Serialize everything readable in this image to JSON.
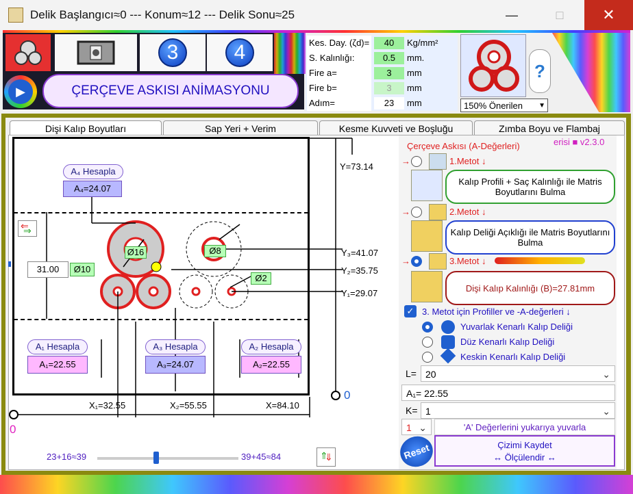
{
  "window": {
    "title": "Delik Başlangıcı≈0 --- Konum≈12 --- Delik Sonu≈25",
    "close_glyph": "✕",
    "maximize_glyph": "□",
    "minimize_glyph": "—"
  },
  "toolbar": {
    "tile3": "3",
    "tile4": "4",
    "animation_label": "ÇERÇEVE ASKISI ANİMASYONU",
    "help_glyph": "?",
    "zoom_select": "150% Önerilen"
  },
  "params": [
    {
      "label": "Kes. Day. (ζd)=",
      "value": "40",
      "unit": "Kg/mm²"
    },
    {
      "label": "S. Kalınlığı: (T)=",
      "value": "0.5",
      "unit": "mm."
    },
    {
      "label": "Fire a=",
      "value": "3",
      "unit": "mm"
    },
    {
      "label": "Fire b=",
      "value": "3",
      "unit": "mm"
    },
    {
      "label": "Adım=",
      "value": "23",
      "unit": "mm"
    }
  ],
  "tabs": [
    "Dişi Kalıp Boyutları",
    "Sap Yeri + Verim",
    "Kesme Kuvveti ve Boşluğu",
    "Zımba Boyu ve Flambaj"
  ],
  "drawing": {
    "a4_button": "A₄ Hesapla",
    "a4_value": "A₄=24.07",
    "a1_button": "A₁ Hesapla",
    "a1_value": "A₁=22.55",
    "a3_button": "A₃ Hesapla",
    "a3_value": "A₃=24.07",
    "a2_button": "A₂ Hesapla",
    "a2_value": "A₂=22.55",
    "height_value": "31.00",
    "d16": "Ø16",
    "d10": "Ø10",
    "d8": "Ø8",
    "d2": "Ø2",
    "y": "Y=73.14",
    "y3": "Y₃=41.07",
    "y2": "Y₂=35.75",
    "y1": "Y₁=29.07",
    "x1": "X₁=32.55",
    "x2": "X₂=55.55",
    "x": "X=84.10",
    "origin_right": "0",
    "origin_left": "0",
    "slider_left": "23+16≈39",
    "slider_right": "39+45≈84"
  },
  "right_panel": {
    "header": "Çerçeve Askısı (A-Değerleri)",
    "version": "erisi ■ v2.3.0",
    "m1_label": "1.Metot ↓",
    "m1_button": "Kalıp Profili + Saç Kalınlığı ile Matris Boyutlarını Bulma",
    "m2_label": "2.Metot ↓",
    "m2_button": "Kalıp Deliği Açıklığı ile Matris Boyutlarını Bulma",
    "m3_label": "3.Metot ↓",
    "m3_button": "Dişi Kalıp Kalınlığı (B)=27.81mm",
    "checkbox_label": "3. Metot için Profiller ve -A-değerleri ↓",
    "options": [
      "Yuvarlak Kenarlı Kalıp Deliği",
      "Düz Kenarlı Kalıp Deliği",
      "Keskin Kenarlı Kalıp Deliği"
    ],
    "l_label": "L=",
    "l_value": "20",
    "a1_text": "A₁= 22.55",
    "k_label": "K=",
    "k_value": "1",
    "round_select": "1",
    "round_text": "'A' Değerlerini yukarıya yuvarla",
    "reset_label": "Reset",
    "save_button": "Çizimi Kaydet\n↔ Ölçülendir ↔"
  },
  "colors": {
    "accent_red": "#e02020",
    "accent_blue": "#1f5fcf",
    "frame": "#8a8a10",
    "hesapla_fill": "#ffb8ff",
    "value_fill_blue": "#b8b8ff"
  }
}
